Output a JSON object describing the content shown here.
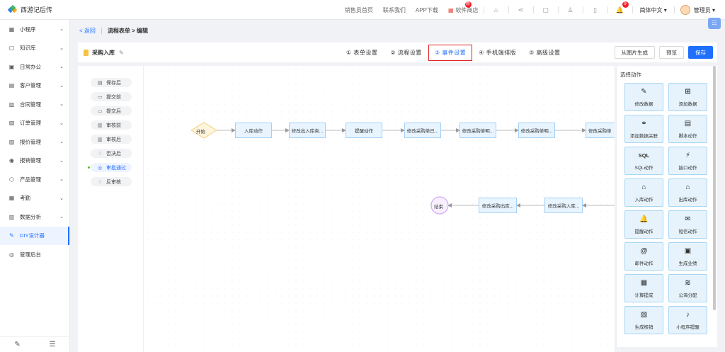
{
  "app": {
    "title": "西游记后传"
  },
  "topbar": {
    "links": [
      "销售员首页",
      "联系我们",
      "APP下载",
      "软件商店"
    ],
    "store_badge": "新",
    "notif_count": "9",
    "language": "简体中文",
    "user": "管理员"
  },
  "sidebar": {
    "items": [
      {
        "label": "小程序",
        "icon": "grid-icon",
        "glyph": "▦"
      },
      {
        "label": "知识库",
        "icon": "book-icon",
        "glyph": "▢"
      },
      {
        "label": "日常办公",
        "icon": "briefcase-icon",
        "glyph": "▣"
      },
      {
        "label": "客户管理",
        "icon": "customer-icon",
        "glyph": "▤"
      },
      {
        "label": "合同管理",
        "icon": "contract-icon",
        "glyph": "▥"
      },
      {
        "label": "订单管理",
        "icon": "order-icon",
        "glyph": "▧"
      },
      {
        "label": "报价管理",
        "icon": "quote-icon",
        "glyph": "▨"
      },
      {
        "label": "报销管理",
        "icon": "reimburse-icon",
        "glyph": "◉"
      },
      {
        "label": "产品管理",
        "icon": "product-icon",
        "glyph": "⬡"
      },
      {
        "label": "考勤",
        "icon": "attendance-icon",
        "glyph": "▦"
      },
      {
        "label": "数据分析",
        "icon": "chart-icon",
        "glyph": "▥"
      },
      {
        "label": "DIY设计器",
        "icon": "designer-icon",
        "glyph": "✎"
      },
      {
        "label": "管理后台",
        "icon": "admin-icon",
        "glyph": "◎"
      }
    ]
  },
  "breadcrumb": {
    "back": "返回",
    "current": "流程表单 > 编辑"
  },
  "header": {
    "form_name": "采购入库",
    "tabs": [
      "① 表单设置",
      "② 流程设置",
      "③ 事件设置",
      "④ 手机端排版",
      "⑤ 高级设置"
    ],
    "active_tab": 2,
    "buttons": {
      "from_image": "从图片生成",
      "preview": "预览",
      "save": "保存"
    }
  },
  "events": [
    {
      "label": "保存后",
      "glyph": "▤"
    },
    {
      "label": "提交前",
      "glyph": "▭"
    },
    {
      "label": "提交后",
      "glyph": "▭"
    },
    {
      "label": "审核前",
      "glyph": "▥"
    },
    {
      "label": "审核后",
      "glyph": "▥"
    },
    {
      "label": "否决后",
      "glyph": "♢"
    },
    {
      "label": "审批通过",
      "glyph": "◎",
      "active": true
    },
    {
      "label": "反审核",
      "glyph": "♢"
    }
  ],
  "flow": {
    "start": "开始",
    "end": "结束",
    "row1": [
      "入库动作",
      "修改出入库类...",
      "提醒动作",
      "修改采购单已...",
      "修改采购单明...",
      "修改采购单明...",
      "修改采购单"
    ],
    "row2": [
      "修改采购出库...",
      "修改采购入库..."
    ]
  },
  "action_panel": {
    "title": "选择动作",
    "actions": [
      {
        "label": "修改数据",
        "glyph": "✎",
        "icon": "edit-icon"
      },
      {
        "label": "添加数据",
        "glyph": "⊞",
        "icon": "add-icon"
      },
      {
        "label": "添加数据关联",
        "glyph": "⚭",
        "icon": "link-icon"
      },
      {
        "label": "脚本动作",
        "glyph": "▤",
        "icon": "script-icon"
      },
      {
        "label": "SQL动作",
        "glyph": "SQL",
        "icon": "sql-icon"
      },
      {
        "label": "接口动作",
        "glyph": "⚡",
        "icon": "plug-icon"
      },
      {
        "label": "入库动作",
        "glyph": "⌂",
        "icon": "stock-in-icon"
      },
      {
        "label": "出库动作",
        "glyph": "⌂",
        "icon": "stock-out-icon"
      },
      {
        "label": "提醒动作",
        "glyph": "🔔",
        "icon": "bell-icon"
      },
      {
        "label": "短信动作",
        "glyph": "✉",
        "icon": "sms-icon"
      },
      {
        "label": "邮件动作",
        "glyph": "@",
        "icon": "mail-icon"
      },
      {
        "label": "生成业绩",
        "glyph": "▣",
        "icon": "performance-icon"
      },
      {
        "label": "计算提成",
        "glyph": "▦",
        "icon": "commission-icon"
      },
      {
        "label": "公海分配",
        "glyph": "≋",
        "icon": "pool-icon"
      },
      {
        "label": "生成核销",
        "glyph": "▧",
        "icon": "writeoff-icon"
      },
      {
        "label": "小程序提醒",
        "glyph": "♪",
        "icon": "miniapp-bell-icon"
      }
    ]
  }
}
